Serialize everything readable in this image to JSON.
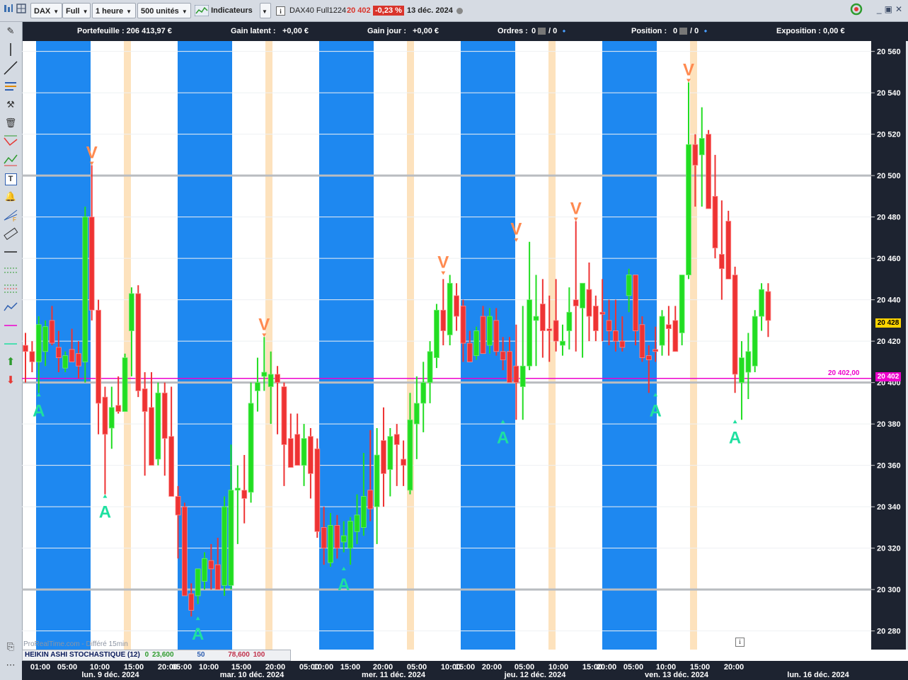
{
  "toolbar": {
    "symbol": "DAX",
    "mode": "Full",
    "period": "1 heure",
    "units": "500 unités",
    "indicators_label": "Indicateurs",
    "instrument": "DAX40 Full1224",
    "last_price": "20 402",
    "change_pct": "-0,23 %",
    "date": "13 déc. 2024"
  },
  "infobar": {
    "portfolio": "Portefeuille : 206 413,97 €",
    "latent_label": "Gain latent :",
    "latent_value": "+0,00 €",
    "day_label": "Gain jour :",
    "day_value": "+0,00 €",
    "orders_label": "Ordres :",
    "orders_a": "0",
    "orders_b": "/ 0",
    "position_label": "Position :",
    "position_a": "0",
    "position_b": "/ 0",
    "exposure": "Exposition : 0,00 €"
  },
  "indicator": {
    "name": "HEIKIN ASHI STOCHASTIQUE (12)",
    "v1": "0",
    "v2": "23,600",
    "v3": "50",
    "v4": "78,600",
    "v5": "100"
  },
  "watermark": "ProRealTime.com - Différé 15min",
  "price_tags": {
    "current": "20 428",
    "line_label": "20 402,00",
    "line_tag": "20 402"
  },
  "xaxis": {
    "times": [
      "01:00",
      "05:00",
      "10:00",
      "15:00",
      "20:00",
      "05:00",
      "10:00",
      "15:00",
      "20:00",
      "05:00",
      "10:00",
      "15:00",
      "20:00",
      "05:00",
      "10:00",
      "15:00",
      "20:00",
      "05:00",
      "10:00",
      "15:00",
      "20:00",
      "05:00",
      "10:00",
      "15:00",
      "20:00"
    ],
    "dates": [
      "lun. 9 déc. 2024",
      "mar. 10 déc. 2024",
      "mer. 11 déc. 2024",
      "jeu. 12 déc. 2024",
      "ven. 13 déc. 2024",
      "lun. 16 déc. 2024"
    ]
  },
  "colors": {
    "bull": "#22dd22",
    "bear": "#ee3333",
    "band_blue": "#1e88f0",
    "band_orange": "#fde2bd",
    "sell_signal": "#ff8a50",
    "buy_signal": "#1ee0a0",
    "price_line": "#ee00cc"
  },
  "chart_data": {
    "type": "candlestick",
    "timeframe": "1 heure",
    "y_ticks": [
      20280,
      20300,
      20320,
      20340,
      20360,
      20380,
      20400,
      20420,
      20440,
      20460,
      20480,
      20500,
      20520,
      20540,
      20560
    ],
    "y_tick_labels": [
      "20 280",
      "20 300",
      "20 320",
      "20 340",
      "20 360",
      "20 380",
      "20 400",
      "20 420",
      "20 440",
      "20 460",
      "20 480",
      "20 500",
      "20 520",
      "20 540",
      "20 560"
    ],
    "ylim": [
      20271,
      20565
    ],
    "horizontal_line": 20402,
    "candles": [
      {
        "o": 20418,
        "h": 20424,
        "l": 20400,
        "c": 20415
      },
      {
        "o": 20415,
        "h": 20420,
        "l": 20405,
        "c": 20410
      },
      {
        "o": 20410,
        "h": 20432,
        "l": 20395,
        "c": 20428
      },
      {
        "o": 20415,
        "h": 20430,
        "l": 20408,
        "c": 20427
      },
      {
        "o": 20430,
        "h": 20437,
        "l": 20418,
        "c": 20419
      },
      {
        "o": 20417,
        "h": 20425,
        "l": 20405,
        "c": 20412
      },
      {
        "o": 20407,
        "h": 20415,
        "l": 20405,
        "c": 20413
      },
      {
        "o": 20416,
        "h": 20426,
        "l": 20411,
        "c": 20410
      },
      {
        "o": 20414,
        "h": 20420,
        "l": 20402,
        "c": 20408
      },
      {
        "o": 20410,
        "h": 20485,
        "l": 20400,
        "c": 20480
      },
      {
        "o": 20480,
        "h": 20505,
        "l": 20430,
        "c": 20435
      },
      {
        "o": 20435,
        "h": 20440,
        "l": 20375,
        "c": 20390
      },
      {
        "o": 20393,
        "h": 20398,
        "l": 20346,
        "c": 20375
      },
      {
        "o": 20378,
        "h": 20398,
        "l": 20368,
        "c": 20388
      },
      {
        "o": 20389,
        "h": 20403,
        "l": 20385,
        "c": 20386
      },
      {
        "o": 20386,
        "h": 20414,
        "l": 20386,
        "c": 20412
      },
      {
        "o": 20425,
        "h": 20446,
        "l": 20403,
        "c": 20443
      },
      {
        "o": 20443,
        "h": 20447,
        "l": 20393,
        "c": 20396
      },
      {
        "o": 20397,
        "h": 20405,
        "l": 20355,
        "c": 20386
      },
      {
        "o": 20388,
        "h": 20405,
        "l": 20360,
        "c": 20360
      },
      {
        "o": 20363,
        "h": 20400,
        "l": 20360,
        "c": 20395
      },
      {
        "o": 20395,
        "h": 20400,
        "l": 20355,
        "c": 20373
      },
      {
        "o": 20374,
        "h": 20398,
        "l": 20345,
        "c": 20345
      },
      {
        "o": 20345,
        "h": 20350,
        "l": 20315,
        "c": 20336
      },
      {
        "o": 20340,
        "h": 20342,
        "l": 20297,
        "c": 20297
      },
      {
        "o": 20298,
        "h": 20303,
        "l": 20287,
        "c": 20290
      },
      {
        "o": 20297,
        "h": 20310,
        "l": 20293,
        "c": 20310
      },
      {
        "o": 20304,
        "h": 20318,
        "l": 20300,
        "c": 20315
      },
      {
        "o": 20314,
        "h": 20322,
        "l": 20300,
        "c": 20310
      },
      {
        "o": 20312,
        "h": 20325,
        "l": 20300,
        "c": 20300
      },
      {
        "o": 20302,
        "h": 20345,
        "l": 20297,
        "c": 20340
      },
      {
        "o": 20302,
        "h": 20370,
        "l": 20300,
        "c": 20348
      },
      {
        "o": 20348,
        "h": 20360,
        "l": 20322,
        "c": 20349
      },
      {
        "o": 20348,
        "h": 20365,
        "l": 20332,
        "c": 20344
      },
      {
        "o": 20347,
        "h": 20400,
        "l": 20342,
        "c": 20390
      },
      {
        "o": 20396,
        "h": 20412,
        "l": 20386,
        "c": 20400
      },
      {
        "o": 20403,
        "h": 20422,
        "l": 20396,
        "c": 20405
      },
      {
        "o": 20398,
        "h": 20415,
        "l": 20380,
        "c": 20404
      },
      {
        "o": 20404,
        "h": 20408,
        "l": 20375,
        "c": 20400
      },
      {
        "o": 20398,
        "h": 20400,
        "l": 20350,
        "c": 20370
      },
      {
        "o": 20373,
        "h": 20385,
        "l": 20360,
        "c": 20359
      },
      {
        "o": 20375,
        "h": 20385,
        "l": 20360,
        "c": 20360
      },
      {
        "o": 20360,
        "h": 20380,
        "l": 20350,
        "c": 20373
      },
      {
        "o": 20374,
        "h": 20378,
        "l": 20344,
        "c": 20356
      },
      {
        "o": 20368,
        "h": 20373,
        "l": 20325,
        "c": 20328
      },
      {
        "o": 20330,
        "h": 20340,
        "l": 20312,
        "c": 20320
      },
      {
        "o": 20313,
        "h": 20337,
        "l": 20311,
        "c": 20331
      },
      {
        "o": 20331,
        "h": 20336,
        "l": 20315,
        "c": 20320
      },
      {
        "o": 20323,
        "h": 20333,
        "l": 20318,
        "c": 20326
      },
      {
        "o": 20320,
        "h": 20335,
        "l": 20312,
        "c": 20333
      },
      {
        "o": 20328,
        "h": 20346,
        "l": 20322,
        "c": 20336
      },
      {
        "o": 20330,
        "h": 20366,
        "l": 20326,
        "c": 20345
      },
      {
        "o": 20348,
        "h": 20377,
        "l": 20333,
        "c": 20339
      },
      {
        "o": 20340,
        "h": 20378,
        "l": 20322,
        "c": 20365
      },
      {
        "o": 20372,
        "h": 20388,
        "l": 20340,
        "c": 20356
      },
      {
        "o": 20358,
        "h": 20378,
        "l": 20345,
        "c": 20374
      },
      {
        "o": 20375,
        "h": 20380,
        "l": 20350,
        "c": 20370
      },
      {
        "o": 20363,
        "h": 20372,
        "l": 20350,
        "c": 20360
      },
      {
        "o": 20348,
        "h": 20395,
        "l": 20346,
        "c": 20382
      },
      {
        "o": 20380,
        "h": 20403,
        "l": 20363,
        "c": 20390
      },
      {
        "o": 20390,
        "h": 20410,
        "l": 20376,
        "c": 20400
      },
      {
        "o": 20400,
        "h": 20420,
        "l": 20390,
        "c": 20415
      },
      {
        "o": 20412,
        "h": 20438,
        "l": 20407,
        "c": 20435
      },
      {
        "o": 20435,
        "h": 20450,
        "l": 20418,
        "c": 20425
      },
      {
        "o": 20423,
        "h": 20452,
        "l": 20418,
        "c": 20448
      },
      {
        "o": 20442,
        "h": 20448,
        "l": 20425,
        "c": 20432
      },
      {
        "o": 20437,
        "h": 20440,
        "l": 20410,
        "c": 20419
      },
      {
        "o": 20419,
        "h": 20425,
        "l": 20410,
        "c": 20410
      },
      {
        "o": 20413,
        "h": 20427,
        "l": 20411,
        "c": 20425
      },
      {
        "o": 20432,
        "h": 20437,
        "l": 20414,
        "c": 20414
      },
      {
        "o": 20418,
        "h": 20436,
        "l": 20414,
        "c": 20432
      },
      {
        "o": 20430,
        "h": 20436,
        "l": 20413,
        "c": 20415
      },
      {
        "o": 20415,
        "h": 20422,
        "l": 20406,
        "c": 20411
      },
      {
        "o": 20415,
        "h": 20422,
        "l": 20400,
        "c": 20400
      },
      {
        "o": 20408,
        "h": 20428,
        "l": 20382,
        "c": 20400
      },
      {
        "o": 20398,
        "h": 20437,
        "l": 20382,
        "c": 20408
      },
      {
        "o": 20408,
        "h": 20468,
        "l": 20406,
        "c": 20440
      },
      {
        "o": 20430,
        "h": 20452,
        "l": 20408,
        "c": 20432
      },
      {
        "o": 20438,
        "h": 20450,
        "l": 20412,
        "c": 20425
      },
      {
        "o": 20426,
        "h": 20442,
        "l": 20410,
        "c": 20425
      },
      {
        "o": 20430,
        "h": 20450,
        "l": 20415,
        "c": 20420
      },
      {
        "o": 20418,
        "h": 20428,
        "l": 20413,
        "c": 20420
      },
      {
        "o": 20425,
        "h": 20446,
        "l": 20416,
        "c": 20434
      },
      {
        "o": 20440,
        "h": 20478,
        "l": 20415,
        "c": 20437
      },
      {
        "o": 20436,
        "h": 20447,
        "l": 20412,
        "c": 20448
      },
      {
        "o": 20445,
        "h": 20458,
        "l": 20420,
        "c": 20432
      },
      {
        "o": 20437,
        "h": 20442,
        "l": 20420,
        "c": 20425
      },
      {
        "o": 20434,
        "h": 20450,
        "l": 20420,
        "c": 20433
      },
      {
        "o": 20430,
        "h": 20440,
        "l": 20418,
        "c": 20425
      },
      {
        "o": 20425,
        "h": 20440,
        "l": 20415,
        "c": 20420
      },
      {
        "o": 20420,
        "h": 20432,
        "l": 20415,
        "c": 20417
      },
      {
        "o": 20442,
        "h": 20455,
        "l": 20434,
        "c": 20452
      },
      {
        "o": 20452,
        "h": 20438,
        "l": 20418,
        "c": 20425
      },
      {
        "o": 20428,
        "h": 20432,
        "l": 20410,
        "c": 20412
      },
      {
        "o": 20413,
        "h": 20418,
        "l": 20395,
        "c": 20411
      },
      {
        "o": 20416,
        "h": 20427,
        "l": 20410,
        "c": 20415
      },
      {
        "o": 20418,
        "h": 20435,
        "l": 20413,
        "c": 20432
      },
      {
        "o": 20428,
        "h": 20437,
        "l": 20413,
        "c": 20426
      },
      {
        "o": 20430,
        "h": 20437,
        "l": 20420,
        "c": 20415
      },
      {
        "o": 20424,
        "h": 20452,
        "l": 20418,
        "c": 20452
      },
      {
        "o": 20452,
        "h": 20545,
        "l": 20450,
        "c": 20515
      },
      {
        "o": 20515,
        "h": 20520,
        "l": 20485,
        "c": 20505
      },
      {
        "o": 20510,
        "h": 20533,
        "l": 20485,
        "c": 20518
      },
      {
        "o": 20520,
        "h": 20522,
        "l": 20487,
        "c": 20484
      },
      {
        "o": 20490,
        "h": 20510,
        "l": 20460,
        "c": 20465
      },
      {
        "o": 20462,
        "h": 20488,
        "l": 20440,
        "c": 20455
      },
      {
        "o": 20478,
        "h": 20483,
        "l": 20455,
        "c": 20450
      },
      {
        "o": 20452,
        "h": 20456,
        "l": 20395,
        "c": 20404
      },
      {
        "o": 20400,
        "h": 20420,
        "l": 20382,
        "c": 20412
      },
      {
        "o": 20405,
        "h": 20424,
        "l": 20392,
        "c": 20415
      },
      {
        "o": 20408,
        "h": 20435,
        "l": 20405,
        "c": 20432
      },
      {
        "o": 20432,
        "h": 20448,
        "l": 20425,
        "c": 20445
      },
      {
        "o": 20444,
        "h": 20448,
        "l": 20422,
        "c": 20430
      }
    ],
    "sell_signals": [
      {
        "candle": 10,
        "price": 20505,
        "label": "V"
      },
      {
        "candle": 36,
        "price": 20422,
        "label": "V"
      },
      {
        "candle": 63,
        "price": 20452,
        "label": "V"
      },
      {
        "candle": 74,
        "price": 20468,
        "label": "V"
      },
      {
        "candle": 83,
        "price": 20478,
        "label": "V"
      },
      {
        "candle": 100,
        "price": 20545,
        "label": "V"
      }
    ],
    "buy_signals": [
      {
        "candle": 2,
        "price": 20395,
        "label": "A"
      },
      {
        "candle": 12,
        "price": 20346,
        "label": "A"
      },
      {
        "candle": 26,
        "price": 20287,
        "label": "A"
      },
      {
        "candle": 48,
        "price": 20311,
        "label": "A"
      },
      {
        "candle": 72,
        "price": 20382,
        "label": "A"
      },
      {
        "candle": 95,
        "price": 20395,
        "label": "A"
      },
      {
        "candle": 107,
        "price": 20382,
        "label": "A"
      }
    ]
  }
}
